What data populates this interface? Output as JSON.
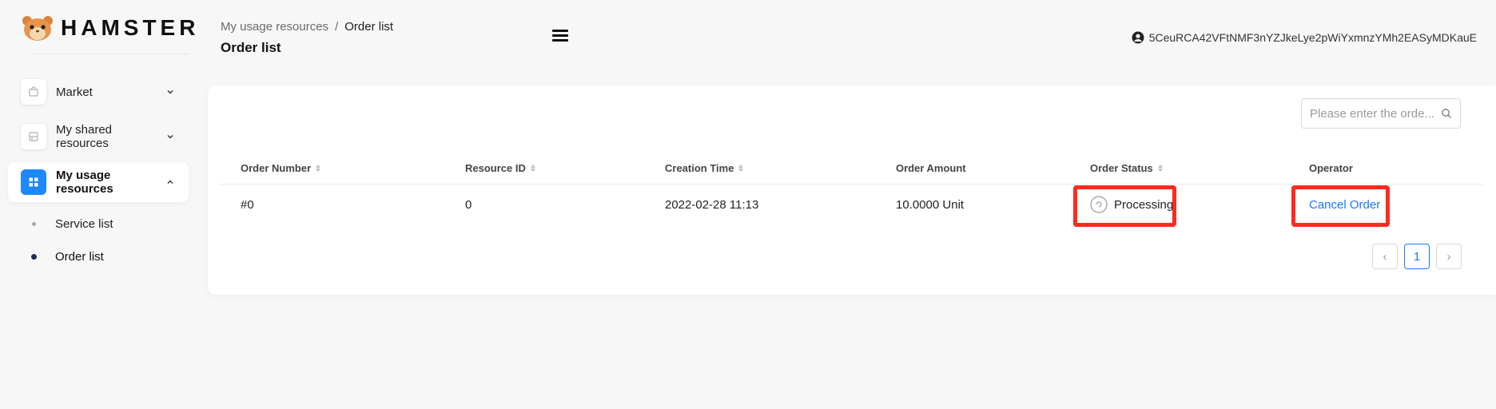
{
  "brand": {
    "name": "HAMSTER"
  },
  "sidebar": {
    "items": [
      {
        "label": "Market",
        "icon": "bag-icon",
        "expanded": false
      },
      {
        "label": "My shared resources",
        "icon": "server-icon",
        "expanded": false
      },
      {
        "label": "My usage resources",
        "icon": "grid-icon",
        "expanded": true
      }
    ],
    "sub_items": [
      {
        "label": "Service list",
        "active": false
      },
      {
        "label": "Order list",
        "active": true
      }
    ]
  },
  "header": {
    "breadcrumb": [
      "My usage resources",
      "Order list"
    ],
    "breadcrumb_separator": "/",
    "title": "Order list",
    "account": "5CeuRCA42VFtNMF3nYZJkeLye2pWiYxmnzYMh2EASyMDKauE"
  },
  "search": {
    "placeholder": "Please enter the orde...",
    "value": ""
  },
  "table": {
    "columns": [
      "Order Number",
      "Resource ID",
      "Creation Time",
      "Order Amount",
      "Order Status",
      "Operator"
    ],
    "rows": [
      {
        "order_number": "#0",
        "resource_id": "0",
        "creation_time": "2022-02-28 11:13",
        "order_amount": "10.0000 Unit",
        "status": "Processing",
        "action": "Cancel Order"
      }
    ]
  },
  "pagination": {
    "current": "1",
    "prev": "‹",
    "next": "›"
  },
  "colors": {
    "accent": "#1677ff",
    "highlight": "#ff2a1f",
    "active_nav": "#1e88ff"
  }
}
